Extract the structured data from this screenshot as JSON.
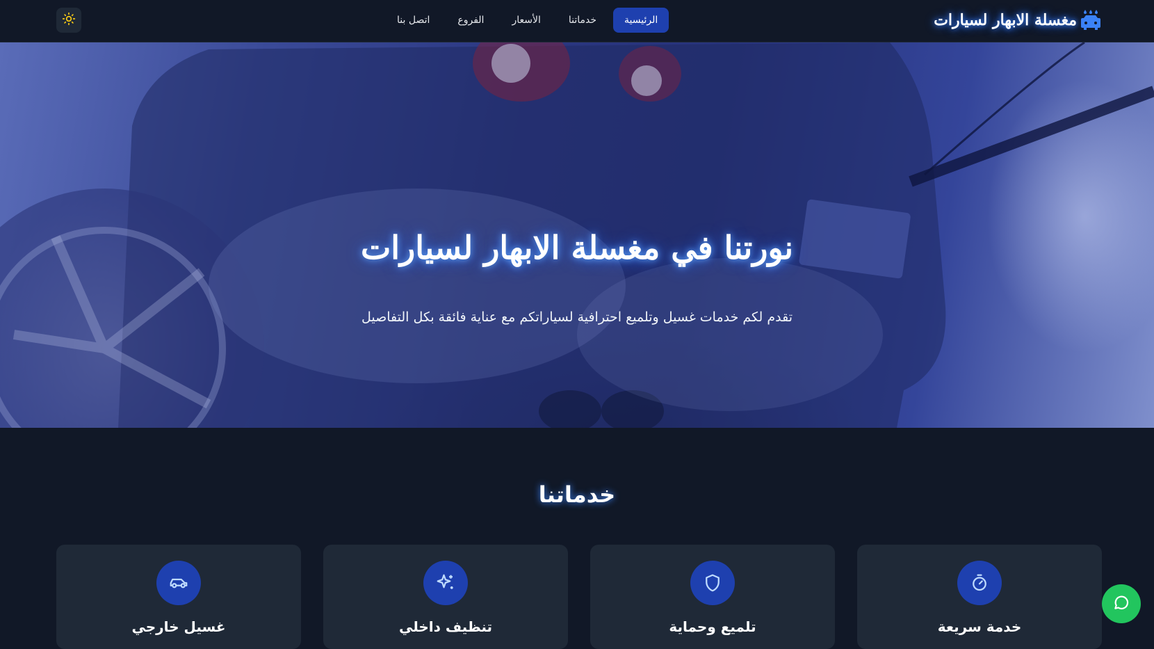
{
  "header": {
    "logo_text": "مغسلة الابهار لسيارات",
    "nav": [
      {
        "label": "الرئيسية",
        "active": true
      },
      {
        "label": "خدماتنا",
        "active": false
      },
      {
        "label": "الأسعار",
        "active": false
      },
      {
        "label": "الفروع",
        "active": false
      },
      {
        "label": "اتصل بنا",
        "active": false
      }
    ],
    "theme_icon": "sun-icon"
  },
  "hero": {
    "title": "نورتنا في مغسلة الابهار لسيارات",
    "subtitle": "تقدم لكم خدمات غسيل وتلميع احترافية لسياراتكم مع عناية فائقة بكل التفاصيل"
  },
  "services": {
    "title": "خدماتنا",
    "cards": [
      {
        "title": "غسيل خارجي",
        "icon": "car-icon"
      },
      {
        "title": "تنظيف داخلي",
        "icon": "sparkles-icon"
      },
      {
        "title": "تلميع وحماية",
        "icon": "shield-icon"
      },
      {
        "title": "خدمة سريعة",
        "icon": "timer-icon"
      }
    ]
  },
  "colors": {
    "background": "#111827",
    "card": "#1f2937",
    "accent": "#1e40af",
    "whatsapp": "#22c55e",
    "sun": "#facc15"
  },
  "floating": {
    "whatsapp_icon": "chat-icon"
  }
}
